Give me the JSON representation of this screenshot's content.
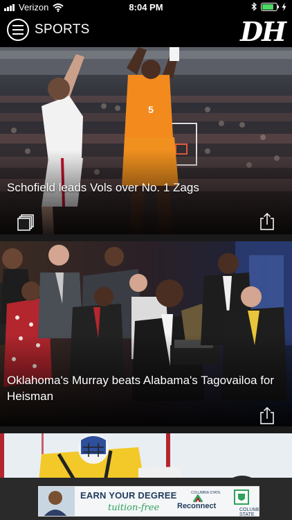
{
  "status_bar": {
    "carrier": "Verizon",
    "time": "8:04 PM",
    "battery_level": 0.8
  },
  "header": {
    "section_title": "SPORTS",
    "logo_text": "DH"
  },
  "feed": {
    "cards": [
      {
        "headline": "Schofield leads Vols over No. 1 Zags",
        "icons": [
          "gallery-icon",
          "share-icon"
        ]
      },
      {
        "headline": "Oklahoma's Murray beats Alabama's Tagovailoa for Heisman",
        "icons": [
          "share-icon"
        ]
      },
      {
        "headline": "",
        "icons": []
      }
    ]
  },
  "ad": {
    "headline": "EARN YOUR DEGREE",
    "subline": "tuition-free",
    "brand_top": "COLUMBIA STATE",
    "brand": "Reconnect",
    "brand_secondary": "COLUMBIA STATE"
  },
  "colors": {
    "accent_orange": "#f28a1e",
    "battery_green": "#4cd964",
    "ad_green": "#2ea35a"
  }
}
